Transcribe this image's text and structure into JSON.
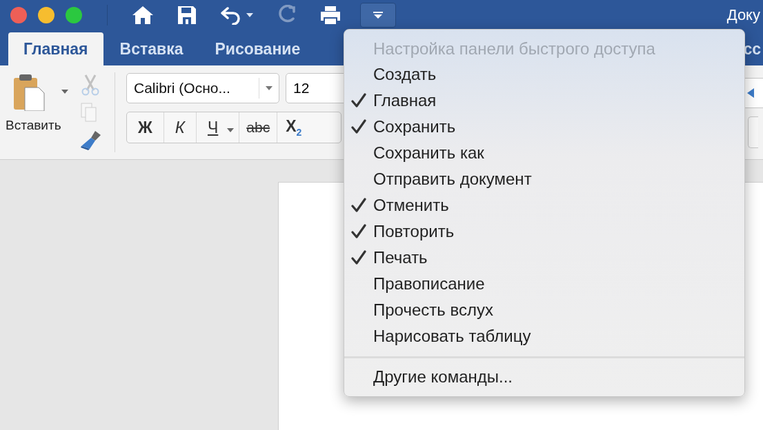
{
  "window": {
    "title": "Доку"
  },
  "quick_access": [
    {
      "kind": "home",
      "disabled": false
    },
    {
      "kind": "save",
      "disabled": false
    },
    {
      "kind": "undo",
      "disabled": false
    },
    {
      "kind": "redo",
      "disabled": true
    },
    {
      "kind": "print",
      "disabled": false
    },
    {
      "kind": "customize",
      "disabled": false,
      "pressed": true
    }
  ],
  "tabs": [
    {
      "label": "Главная",
      "selected": true
    },
    {
      "label": "Вставка",
      "selected": false
    },
    {
      "label": "Рисование",
      "selected": false
    },
    {
      "label": "сс",
      "selected": false
    }
  ],
  "ribbon": {
    "paste": {
      "label": "Вставить"
    },
    "clipboard_tools": [
      {
        "kind": "cut",
        "disabled": true
      },
      {
        "kind": "copy",
        "disabled": true
      },
      {
        "kind": "format_painter",
        "disabled": false
      }
    ],
    "font": {
      "value": "Calibri (Осно..."
    },
    "size": {
      "value": "12"
    },
    "format_buttons": [
      {
        "kind": "bold",
        "label": "Ж"
      },
      {
        "kind": "italic",
        "label": "К"
      },
      {
        "kind": "underline",
        "label": "Ч"
      },
      {
        "kind": "strikethrough",
        "label": "abc"
      },
      {
        "kind": "subscript",
        "label": "X$_{2}$"
      }
    ]
  },
  "menu": {
    "title": "Настройка панели быстрого доступа",
    "items": [
      {
        "label": "Создать",
        "checked": false
      },
      {
        "label": "Главная",
        "checked": true
      },
      {
        "label": "Сохранить",
        "checked": true
      },
      {
        "label": "Сохранить как",
        "checked": false
      },
      {
        "label": "Отправить документ",
        "checked": false
      },
      {
        "label": "Отменить",
        "checked": true
      },
      {
        "label": "Повторить",
        "checked": true
      },
      {
        "label": "Печать",
        "checked": true
      },
      {
        "label": "Правописание",
        "checked": false
      },
      {
        "label": "Прочесть вслух",
        "checked": false
      },
      {
        "label": "Нарисовать таблицу",
        "checked": false
      }
    ],
    "footer": "Другие команды..."
  }
}
